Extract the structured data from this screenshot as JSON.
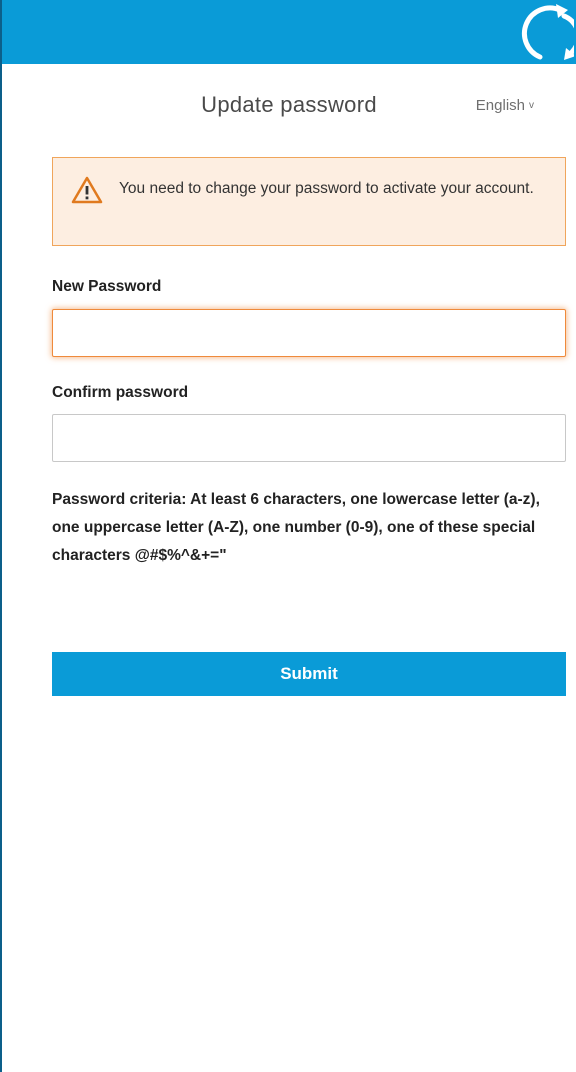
{
  "header": {
    "title": "Update password",
    "language": "English",
    "language_chevron": "v"
  },
  "alert": {
    "icon": "warning-icon",
    "message": "You need to change your password to activate your account."
  },
  "form": {
    "new_password_label": "New Password",
    "new_password_value": "",
    "confirm_password_label": "Confirm password",
    "confirm_password_value": "",
    "criteria": "Password criteria: At least 6 characters, one lowercase letter (a-z), one uppercase letter (A-Z), one number (0-9), one of these special characters @#$%^&+=\"",
    "submit_label": "Submit"
  },
  "colors": {
    "brand_blue": "#0a9bd7",
    "alert_background": "#fdeee1",
    "alert_border": "#f0a55b",
    "focus_orange": "#ef8a3b"
  }
}
